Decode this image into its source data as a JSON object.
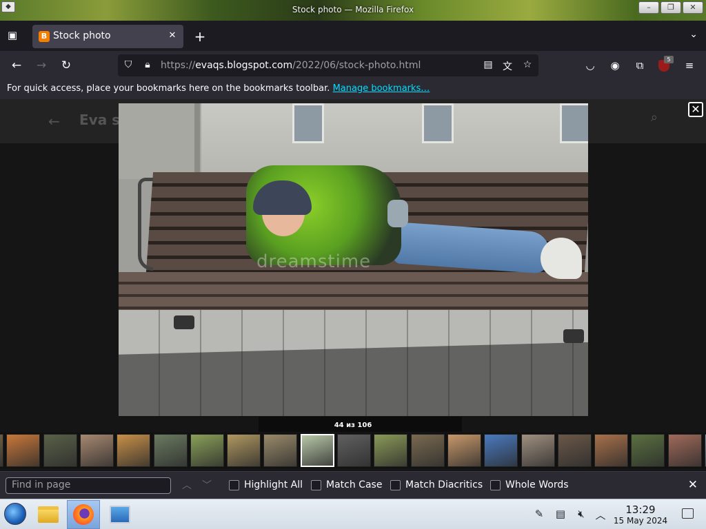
{
  "window": {
    "title": "Stock photo — Mozilla Firefox",
    "min_label": "–",
    "max_label": "❐",
    "close_label": "✕"
  },
  "tab": {
    "favicon": "B",
    "label": "Stock photo",
    "close": "✕",
    "new_tab": "+"
  },
  "nav": {
    "url_prefix": "https://",
    "url_host": "evaqs.blogspot.com",
    "url_path": "/2022/06/stock-photo.html",
    "ext_badge": "5"
  },
  "bookmarks": {
    "text": "For quick access, place your bookmarks here on the bookmarks toolbar.",
    "link": "Manage bookmarks…"
  },
  "page": {
    "header_title": "Eva s",
    "watermark": "dreamstime"
  },
  "lightbox": {
    "counter": "44 из 106",
    "close": "✕"
  },
  "filmstrip": {
    "thumbs": [
      {
        "color": "#7a6a4a"
      },
      {
        "color": "#c8783a"
      },
      {
        "color": "#5a6048"
      },
      {
        "color": "#a88870"
      },
      {
        "color": "#c89048"
      },
      {
        "color": "#6a7a60"
      },
      {
        "color": "#8aa058"
      },
      {
        "color": "#b09860"
      },
      {
        "color": "#9a8a6a"
      },
      {
        "color": "#b8c8a8"
      },
      {
        "color": "#606060"
      },
      {
        "color": "#8a9a58"
      },
      {
        "color": "#7a6a50"
      },
      {
        "color": "#c8986a"
      },
      {
        "color": "#4a7ac0"
      },
      {
        "color": "#a09080"
      },
      {
        "color": "#6a5848"
      },
      {
        "color": "#a8704a"
      },
      {
        "color": "#5a7040"
      },
      {
        "color": "#a06a5a"
      },
      {
        "color": "#8a9aa8"
      }
    ],
    "active_index": 9
  },
  "findbar": {
    "placeholder": "Find in page",
    "options": [
      "Highlight All",
      "Match Case",
      "Match Diacritics",
      "Whole Words"
    ]
  },
  "taskbar": {
    "time": "13:29",
    "date": "15 May 2024"
  }
}
